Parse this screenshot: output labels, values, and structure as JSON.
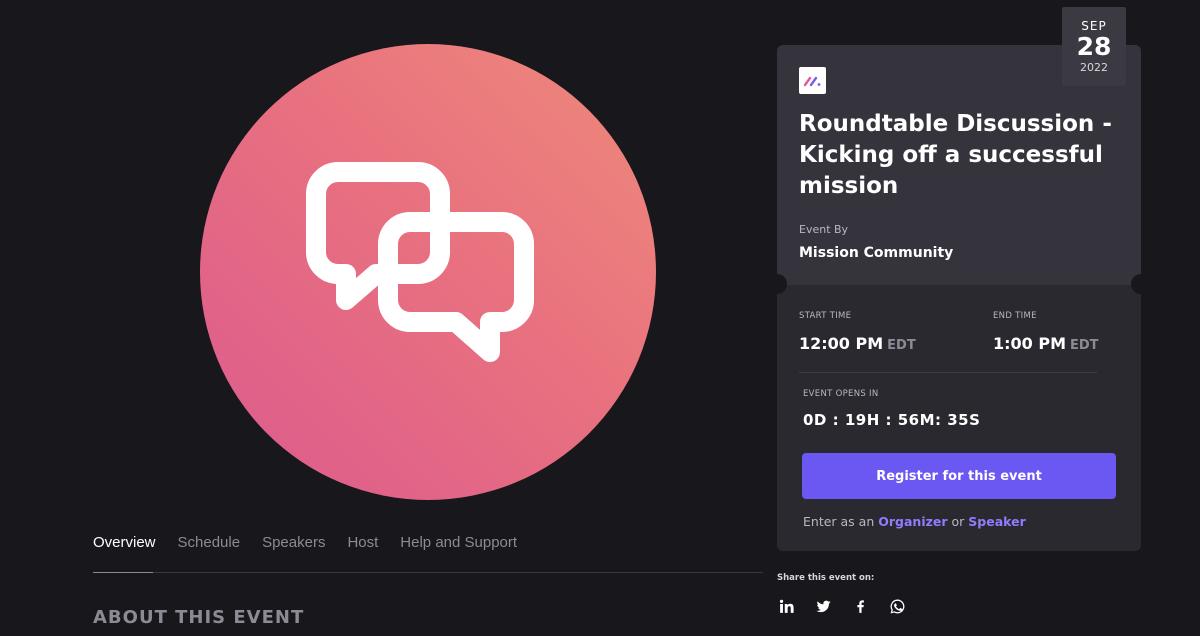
{
  "event": {
    "title": "Roundtable Discussion - Kicking off a successful mission",
    "event_by_label": "Event By",
    "organizer_name": "Mission Community",
    "date": {
      "month": "SEP",
      "day": "28",
      "year": "2022"
    }
  },
  "times": {
    "start_label": "START TIME",
    "start_time": "12:00 PM",
    "start_tz": "EDT",
    "end_label": "END TIME",
    "end_time": "1:00 PM",
    "end_tz": "EDT"
  },
  "countdown": {
    "label": "EVENT OPENS IN",
    "value": "0D : 19H : 56M: 35S"
  },
  "register": {
    "button_label": "Register for this event",
    "enter_prefix": "Enter as an",
    "organizer_link": "Organizer",
    "or_text": "or",
    "speaker_link": "Speaker"
  },
  "tabs": [
    {
      "label": "Overview",
      "active": true
    },
    {
      "label": "Schedule",
      "active": false
    },
    {
      "label": "Speakers",
      "active": false
    },
    {
      "label": "Host",
      "active": false
    },
    {
      "label": "Help and Support",
      "active": false
    }
  ],
  "about": {
    "title": "ABOUT THIS EVENT"
  },
  "share": {
    "label": "Share this event on:",
    "icons": [
      "linkedin-icon",
      "twitter-icon",
      "facebook-icon",
      "whatsapp-icon"
    ]
  },
  "colors": {
    "background": "#18171c",
    "card": "#2a2930",
    "card_top": "#35343d",
    "accent": "#6b57f2",
    "link": "#8f7cff",
    "hero_gradient_start": "#dc5a8e",
    "hero_gradient_end": "#ef8a7b"
  }
}
